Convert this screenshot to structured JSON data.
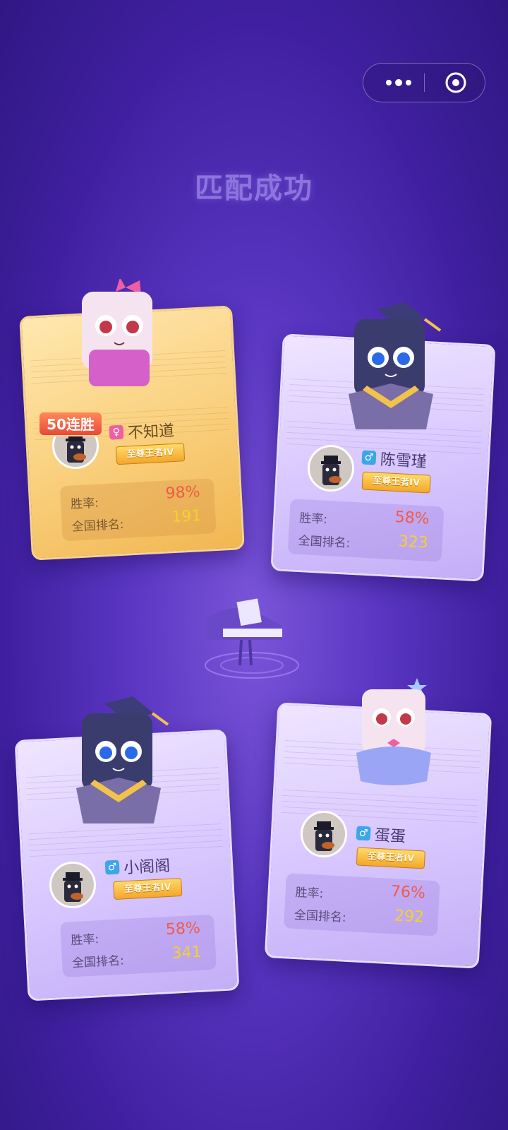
{
  "title": "匹配成功",
  "capsule": {
    "more_icon": "more-dots-icon",
    "close_icon": "target-icon"
  },
  "players": [
    {
      "name": "不知道",
      "gender": "♀",
      "badge": "至尊王者IV",
      "streak": "50连胜",
      "winrate_label": "胜率:",
      "winrate": "98%",
      "rank_label": "全国排名:",
      "rank": "191"
    },
    {
      "name": "陈雪瑾",
      "gender": "♂",
      "badge": "至尊王者IV",
      "winrate_label": "胜率:",
      "winrate": "58%",
      "rank_label": "全国排名:",
      "rank": "323"
    },
    {
      "name": "小阁阁",
      "gender": "♂",
      "badge": "至尊王者IV",
      "winrate_label": "胜率:",
      "winrate": "58%",
      "rank_label": "全国排名:",
      "rank": "341"
    },
    {
      "name": "蛋蛋",
      "gender": "♂",
      "badge": "至尊王者IV",
      "winrate_label": "胜率:",
      "winrate": "76%",
      "rank_label": "全国排名:",
      "rank": "292"
    }
  ],
  "colors": {
    "winrate": "#f05a4a",
    "rank": "#f2d12c",
    "gold_card": "#f9cf7c",
    "lavender_card": "#d7c6ff"
  }
}
